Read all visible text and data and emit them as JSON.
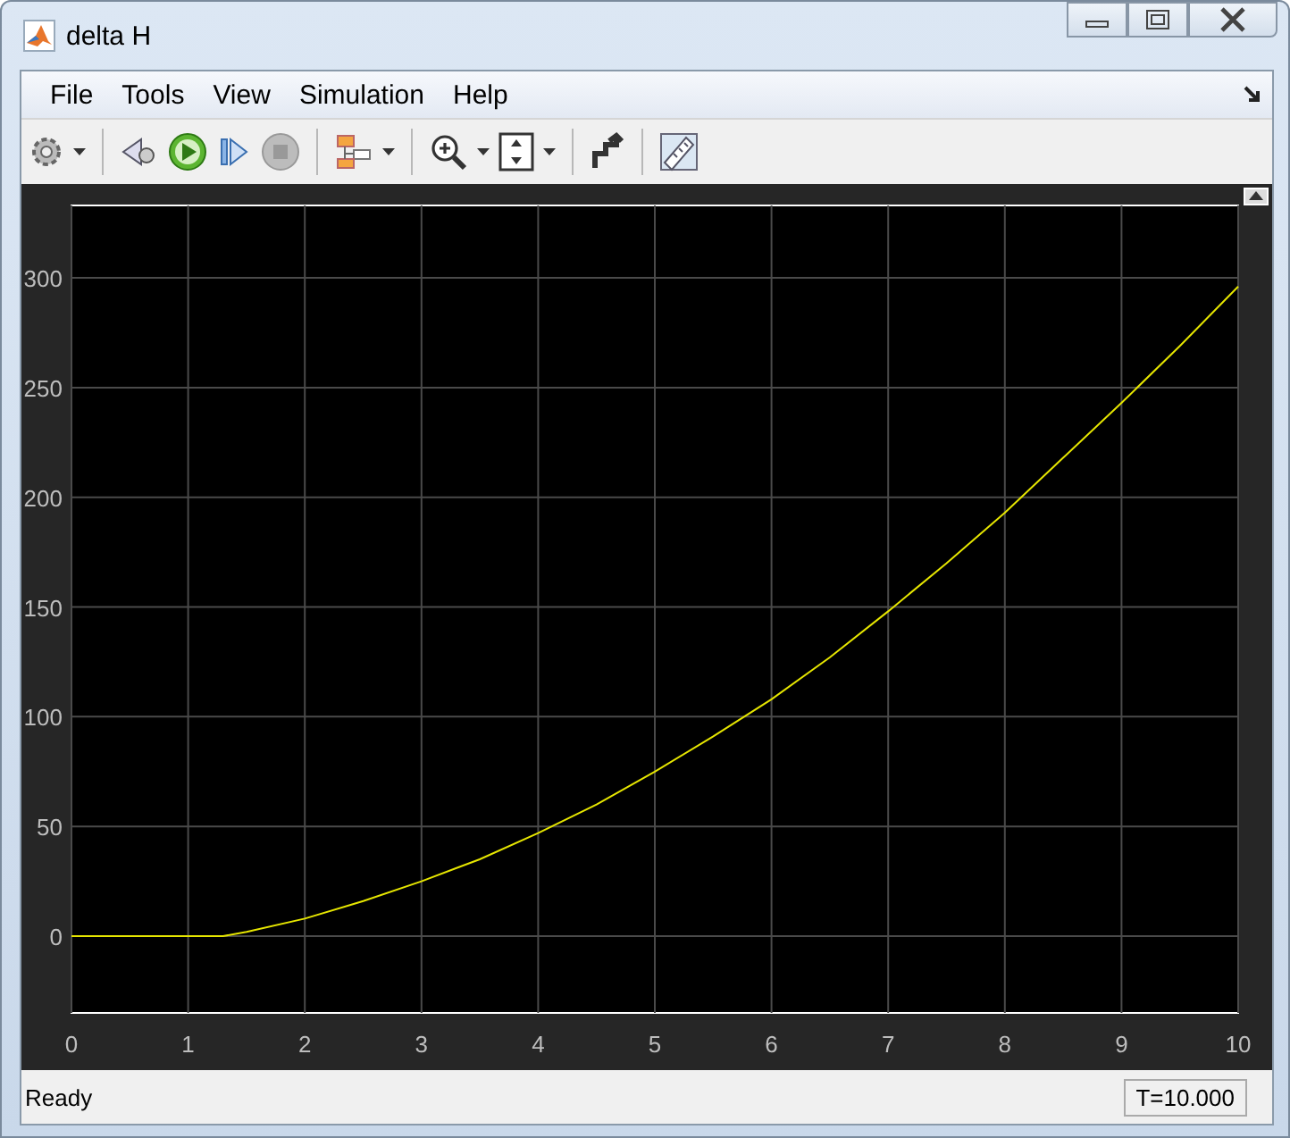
{
  "window": {
    "title": "delta H"
  },
  "menu": [
    "File",
    "Tools",
    "View",
    "Simulation",
    "Help"
  ],
  "plot": {
    "chart_data": {
      "type": "line",
      "x": [
        0,
        0.5,
        1,
        1.3,
        1.5,
        2,
        2.5,
        3,
        3.5,
        4,
        4.5,
        5,
        5.5,
        6,
        6.5,
        7,
        7.5,
        8,
        8.5,
        9,
        9.5,
        10
      ],
      "series": [
        {
          "color": "#e6e600",
          "values": [
            0,
            0,
            0,
            0,
            2,
            8,
            16,
            25,
            35,
            47,
            60,
            75,
            91,
            108,
            127,
            148,
            170,
            193,
            218,
            243,
            269,
            296
          ]
        }
      ],
      "xlim": [
        0,
        10
      ],
      "ylim": [
        -35,
        333
      ],
      "xticks": [
        0,
        1,
        2,
        3,
        4,
        5,
        6,
        7,
        8,
        9,
        10
      ],
      "yticks": [
        0,
        50,
        100,
        150,
        200,
        250,
        300
      ],
      "grid": true
    }
  },
  "status_bar": {
    "message": "Ready",
    "time": "T=10.000"
  }
}
